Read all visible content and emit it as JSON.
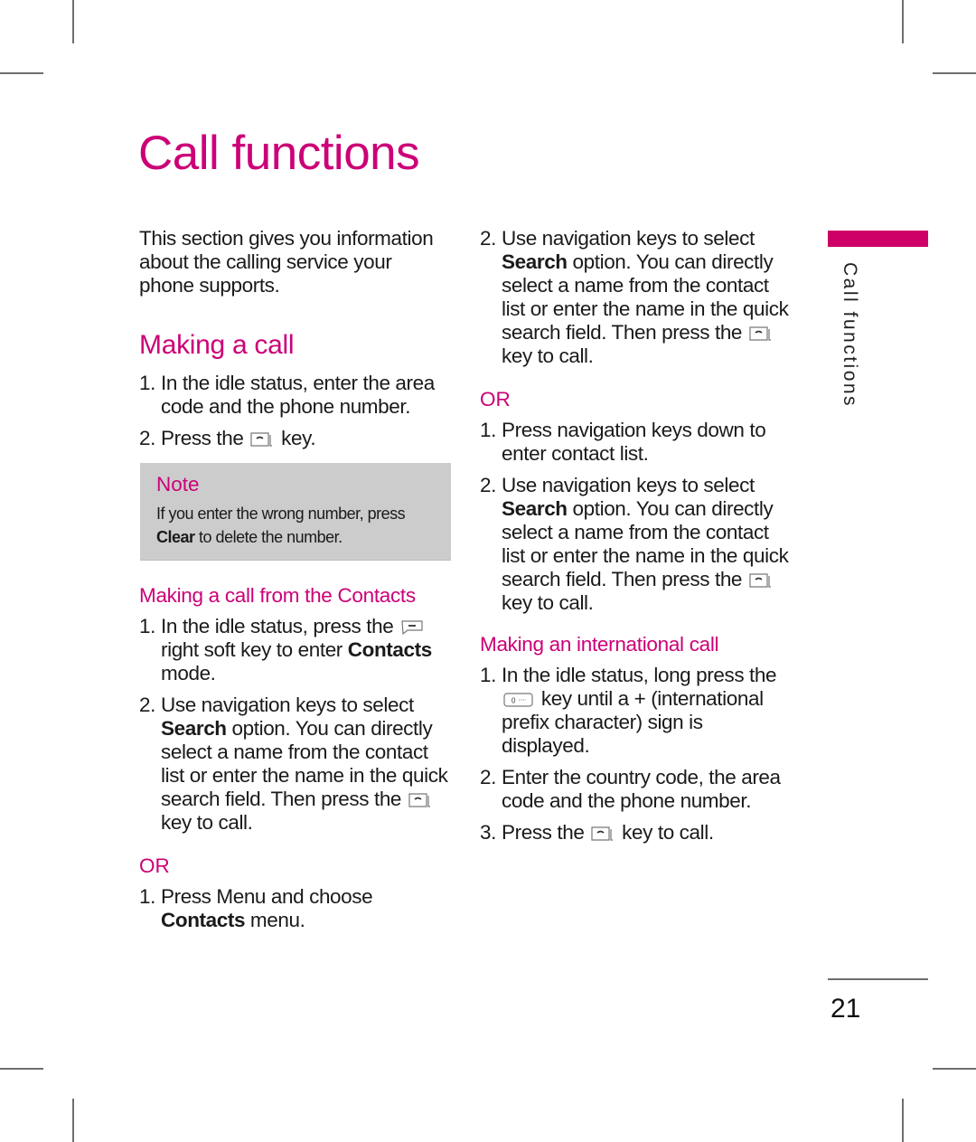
{
  "page": {
    "title": "Call functions",
    "side_tab_label": "Call functions",
    "page_number": "21",
    "accent_color": "#cc0077",
    "note_bg_color": "#cccccc"
  },
  "left_column": {
    "intro": "This section gives you information about the calling service your phone supports.",
    "section_heading": "Making a call",
    "making_call_steps": [
      {
        "num": "1.",
        "text": "In the idle status, enter the area code and the phone number."
      },
      {
        "num": "2.",
        "pre": "Press the",
        "icon": "send-key-icon",
        "post": "key."
      }
    ],
    "note": {
      "title": "Note",
      "text_pre": "If you enter the wrong number, press",
      "bold": "Clear",
      "text_post": "to delete the number."
    },
    "contacts_heading": "Making a call from the Contacts",
    "contacts_steps": [
      {
        "num": "1.",
        "pre": "In the idle status, press the",
        "icon": "right-soft-key-icon",
        "mid": "right soft key to enter",
        "bold": "Contacts",
        "post": "mode."
      },
      {
        "num": "2.",
        "pre": "Use navigation keys to select",
        "bold": "Search",
        "post": "option. You can directly select a name from the contact list or enter the name in the quick search field. Then press the",
        "icon": "send-key-icon",
        "end": "key to call."
      }
    ],
    "or_label": "OR",
    "menu_steps": [
      {
        "num": "1.",
        "pre": "Press Menu and choose",
        "bold": "Contacts",
        "post": "menu."
      }
    ]
  },
  "middle_column": {
    "steps_a": [
      {
        "num": "2.",
        "pre": "Use navigation keys to select",
        "bold": "Search",
        "post": "option. You can directly select a name from the contact list or enter the name in the quick search field. Then press the",
        "icon": "send-key-icon",
        "end": "key to call."
      }
    ],
    "or_label": "OR",
    "steps_b": [
      {
        "num": "1.",
        "text": "Press navigation keys down to enter contact list."
      },
      {
        "num": "2.",
        "pre": "Use navigation keys to select",
        "bold": "Search",
        "post": "option. You can directly select a name from the contact list or enter the name in the quick search field. Then press the",
        "icon": "send-key-icon",
        "end": "key to call."
      }
    ],
    "international_heading": "Making an international call",
    "international_steps": [
      {
        "num": "1.",
        "pre": "In the idle status, long press the",
        "icon": "zero-key-icon",
        "key_label": "0",
        "post": "key until a + (international prefix character) sign is displayed."
      },
      {
        "num": "2.",
        "text": "Enter the country code, the area code and the phone number."
      },
      {
        "num": "3.",
        "pre": "Press the",
        "icon": "send-key-icon",
        "post": "key to call."
      }
    ]
  }
}
